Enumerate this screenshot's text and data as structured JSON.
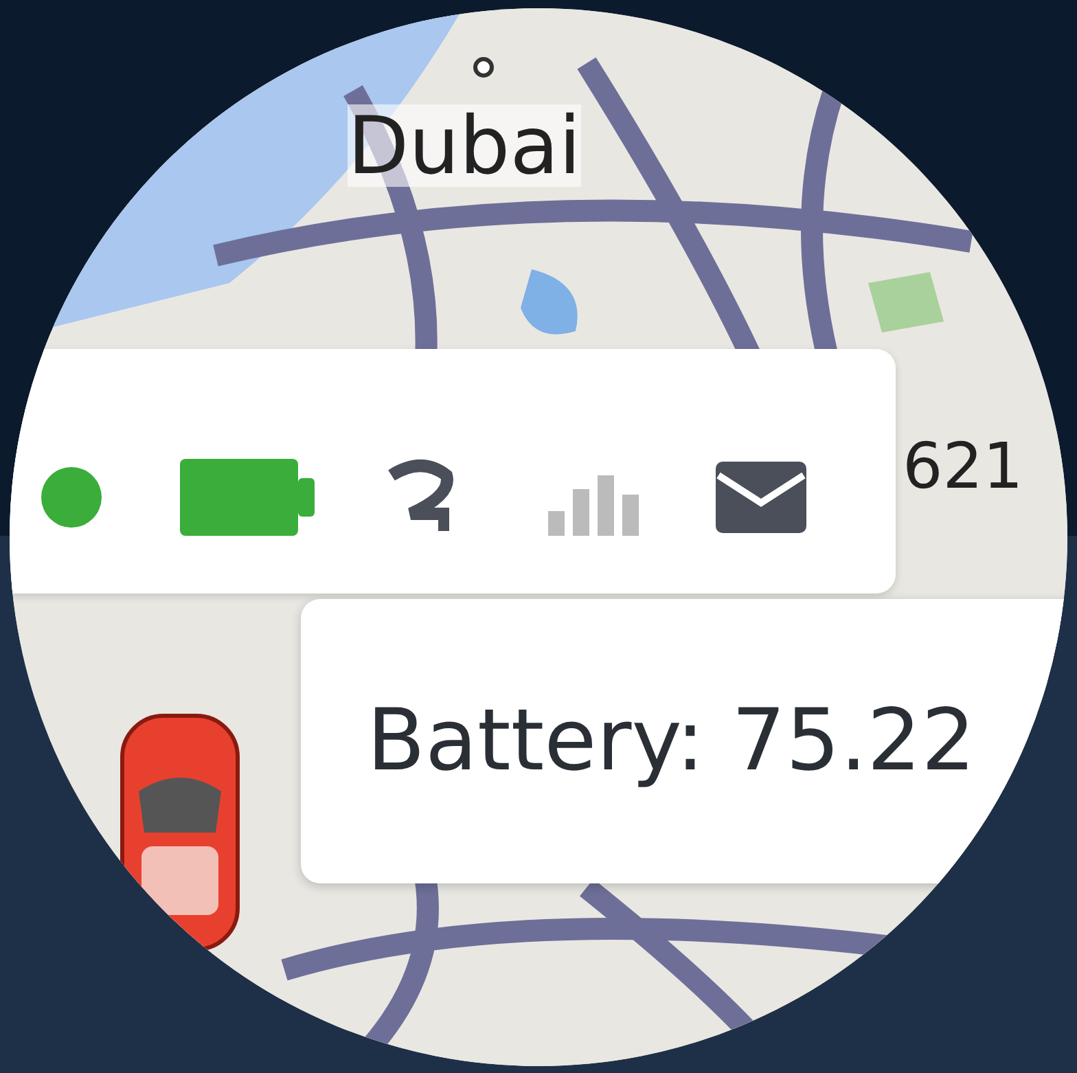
{
  "map": {
    "labels": [
      {
        "text": "Dubai",
        "kind": "city"
      },
      {
        "text": "621",
        "kind": "road"
      }
    ]
  },
  "tooltip": {
    "text": "Battery: 75.22"
  }
}
